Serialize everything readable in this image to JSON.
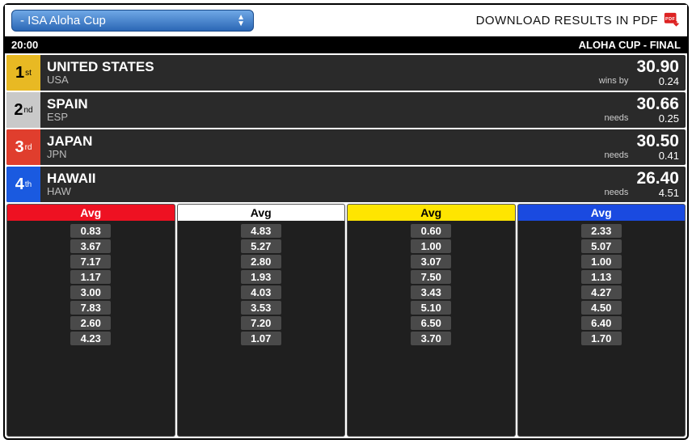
{
  "dropdown": {
    "label": "- ISA Aloha Cup"
  },
  "pdf": {
    "label": "DOWNLOAD RESULTS IN PDF"
  },
  "header": {
    "time": "20:00",
    "title": "ALOHA CUP - FINAL"
  },
  "ranks": [
    {
      "pos": "1",
      "ord": "st",
      "rankclass": "gold",
      "name": "UNITED STATES",
      "code": "USA",
      "status": "wins by",
      "score": "30.90",
      "diff": "0.24"
    },
    {
      "pos": "2",
      "ord": "nd",
      "rankclass": "silver",
      "name": "SPAIN",
      "code": "ESP",
      "status": "needs",
      "score": "30.66",
      "diff": "0.25"
    },
    {
      "pos": "3",
      "ord": "rd",
      "rankclass": "bronze",
      "name": "JAPAN",
      "code": "JPN",
      "status": "needs",
      "score": "30.50",
      "diff": "0.41"
    },
    {
      "pos": "4",
      "ord": "th",
      "rankclass": "blue",
      "name": "HAWAII",
      "code": "HAW",
      "status": "needs",
      "score": "26.40",
      "diff": "4.51"
    }
  ],
  "avg_label": "Avg",
  "avg_columns": [
    {
      "headclass": "red",
      "values": [
        "0.83",
        "3.67",
        "7.17",
        "1.17",
        "3.00",
        "7.83",
        "2.60",
        "4.23"
      ]
    },
    {
      "headclass": "white",
      "values": [
        "4.83",
        "5.27",
        "2.80",
        "1.93",
        "4.03",
        "3.53",
        "7.20",
        "1.07"
      ]
    },
    {
      "headclass": "yellow",
      "values": [
        "0.60",
        "1.00",
        "3.07",
        "7.50",
        "3.43",
        "5.10",
        "6.50",
        "3.70"
      ]
    },
    {
      "headclass": "blue",
      "values": [
        "2.33",
        "5.07",
        "1.00",
        "1.13",
        "4.27",
        "4.50",
        "6.40",
        "1.70"
      ]
    }
  ]
}
